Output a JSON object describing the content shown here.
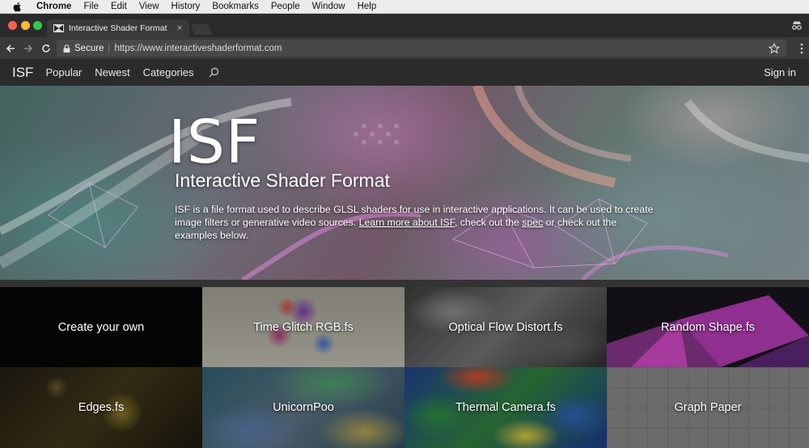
{
  "menubar": {
    "app": "Chrome",
    "items": [
      "File",
      "Edit",
      "View",
      "History",
      "Bookmarks",
      "People",
      "Window",
      "Help"
    ]
  },
  "browser": {
    "tab_title": "Interactive Shader Format",
    "tab_close": "×",
    "secure_label": "Secure",
    "url": "https://www.interactiveshaderformat.com"
  },
  "site_nav": {
    "logo": "ISF",
    "links": [
      "Popular",
      "Newest",
      "Categories"
    ],
    "signin": "Sign in"
  },
  "hero": {
    "title": "ISF",
    "subtitle": "Interactive Shader Format",
    "desc_1": "ISF is a file format used to describe GLSL shaders for use in interactive applications.  It can be used to create image filters or generative video sources. ",
    "link_learn": "Learn more about ISF",
    "desc_2": ", check out the ",
    "link_spec": "spec",
    "desc_3": " or check out the examples below."
  },
  "tiles": [
    {
      "label": "Create your own"
    },
    {
      "label": "Time Glitch RGB.fs"
    },
    {
      "label": "Optical Flow Distort.fs"
    },
    {
      "label": "Random Shape.fs"
    },
    {
      "label": "Edges.fs"
    },
    {
      "label": "UnicornPoo"
    },
    {
      "label": "Thermal Camera.fs"
    },
    {
      "label": "Graph Paper"
    }
  ],
  "colors": {
    "menubar_bg": "#ececec",
    "chrome_dark": "#2a2a2c",
    "toolbar": "#3a3a3c",
    "site_nav_bg": "#2b2b2b"
  }
}
